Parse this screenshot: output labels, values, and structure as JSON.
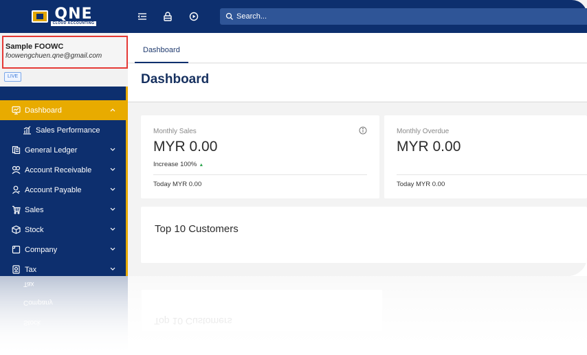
{
  "topbar": {
    "logo_text": "QNE",
    "logo_sub": "CLOUD ACCOUNTING",
    "search_placeholder": "Search..."
  },
  "profile": {
    "name": "Sample FOOWC",
    "email": "foowengchuen.qne@gmail.com",
    "badge": "LIVE"
  },
  "sidebar": {
    "items": [
      {
        "label": "Dashboard",
        "icon": "monitor-icon",
        "active": true,
        "chevron": "up"
      },
      {
        "label": "Sales Performance",
        "icon": "bar-chart-icon",
        "sub": true
      },
      {
        "label": "General Ledger",
        "icon": "ledger-icon",
        "chevron": "down"
      },
      {
        "label": "Account Receivable",
        "icon": "receivable-icon",
        "chevron": "down"
      },
      {
        "label": "Account Payable",
        "icon": "payable-icon",
        "chevron": "down"
      },
      {
        "label": "Sales",
        "icon": "cart-icon",
        "chevron": "down"
      },
      {
        "label": "Stock",
        "icon": "box-icon",
        "chevron": "down"
      },
      {
        "label": "Company",
        "icon": "company-icon",
        "chevron": "down"
      },
      {
        "label": "Tax",
        "icon": "tax-icon",
        "chevron": "down"
      }
    ]
  },
  "main": {
    "tab_label": "Dashboard",
    "page_title": "Dashboard",
    "monthly_sales": {
      "label": "Monthly Sales",
      "value": "MYR 0.00",
      "increase": "Increase 100%",
      "today": "Today MYR 0.00"
    },
    "monthly_overdue": {
      "label": "Monthly Overdue",
      "value": "MYR 0.00",
      "today": "Today MYR 0.00"
    },
    "top10_title": "Top 10 Customers"
  },
  "reflection": {
    "top10_text": "Top 10 Customers",
    "labels": [
      "Tax",
      "Company",
      "Stock"
    ]
  },
  "colors": {
    "navy": "#0d2f6e",
    "accent": "#e8ab00",
    "highlight_border": "#e53935"
  }
}
